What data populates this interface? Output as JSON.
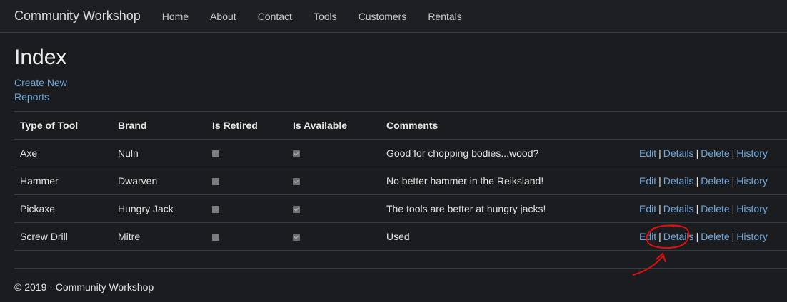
{
  "navbar": {
    "brand": "Community Workshop",
    "items": [
      "Home",
      "About",
      "Contact",
      "Tools",
      "Customers",
      "Rentals"
    ]
  },
  "page": {
    "title": "Index",
    "create_new": "Create New",
    "reports": "Reports"
  },
  "table": {
    "headers": [
      "Type of Tool",
      "Brand",
      "Is Retired",
      "Is Available",
      "Comments"
    ],
    "actions": {
      "edit": "Edit",
      "details": "Details",
      "delete": "Delete",
      "history": "History",
      "separator": "|"
    },
    "rows": [
      {
        "type": "Axe",
        "brand": "Nuln",
        "is_retired": false,
        "is_available": true,
        "comments": "Good for chopping bodies...wood?"
      },
      {
        "type": "Hammer",
        "brand": "Dwarven",
        "is_retired": false,
        "is_available": true,
        "comments": "No better hammer in the Reiksland!"
      },
      {
        "type": "Pickaxe",
        "brand": "Hungry Jack",
        "is_retired": false,
        "is_available": true,
        "comments": "The tools are better at hungry jacks!"
      },
      {
        "type": "Screw Drill",
        "brand": "Mitre",
        "is_retired": false,
        "is_available": true,
        "comments": "Used"
      }
    ]
  },
  "footer": {
    "text": "© 2019 - Community Workshop"
  },
  "colors": {
    "link": "#6fa8dc",
    "background": "#1b1c1f",
    "annotation": "#e01010"
  }
}
